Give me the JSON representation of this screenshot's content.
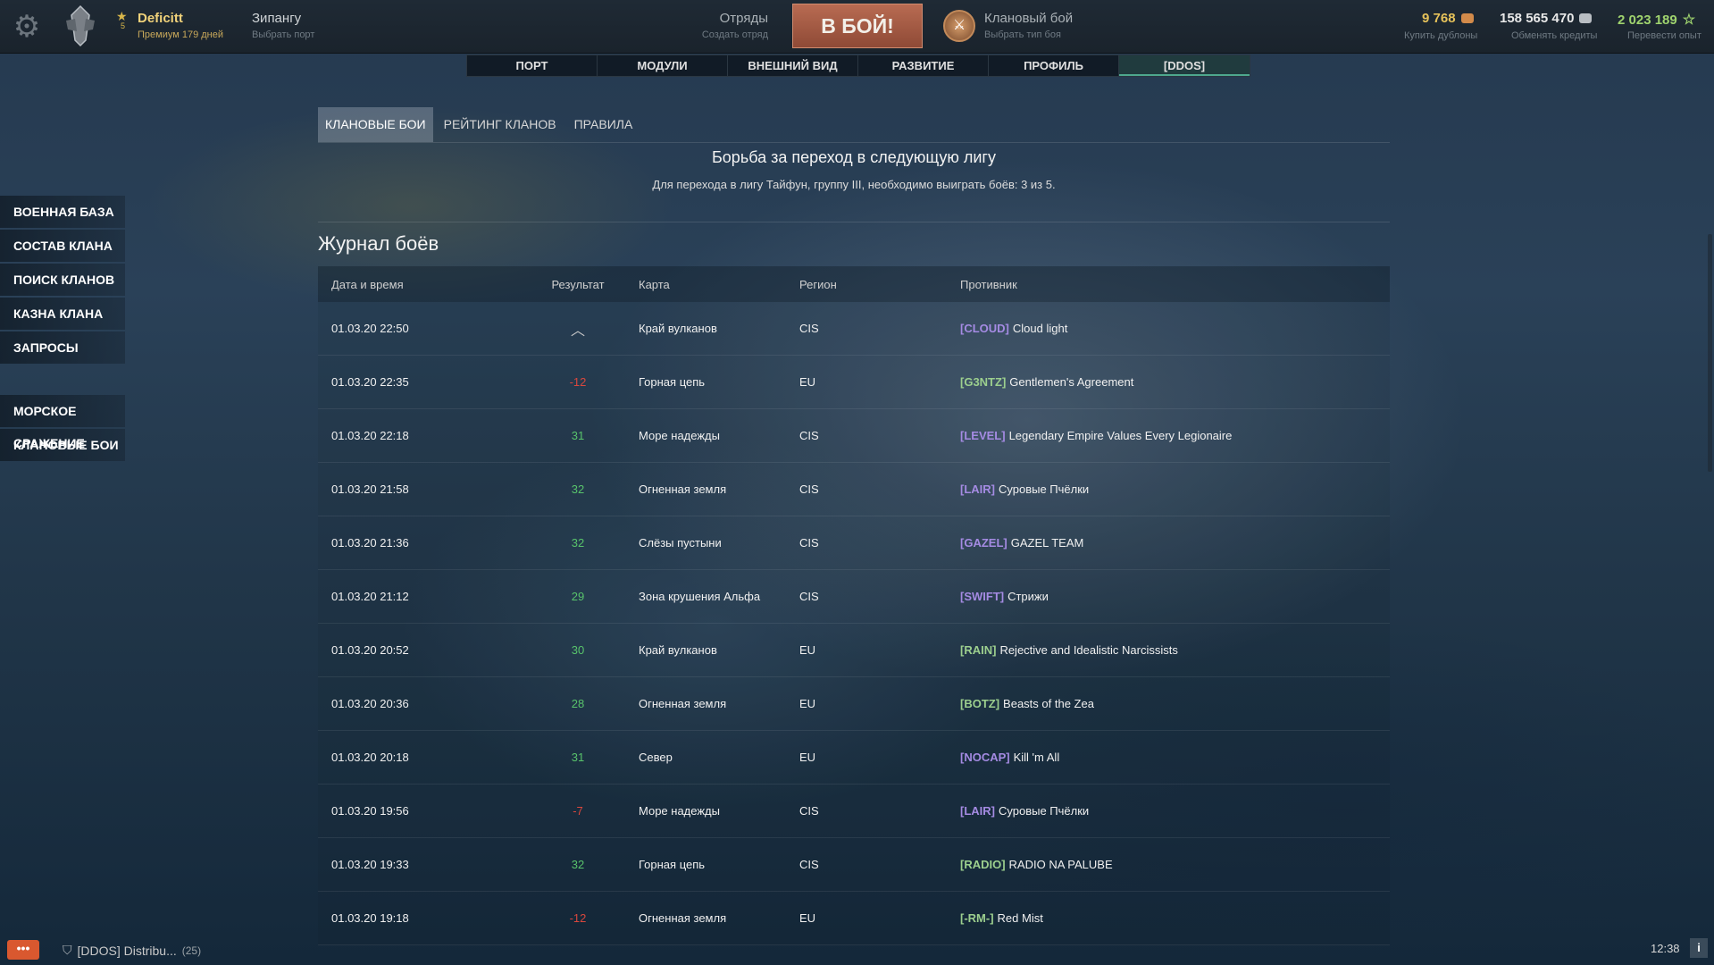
{
  "topbar": {
    "player_level": "5",
    "player_name": "Deficitt",
    "premium": "Премиум 179 дней",
    "port_name": "Зипангу",
    "port_sub": "Выбрать порт",
    "squad_label": "Отряды",
    "squad_sub": "Создать отряд",
    "battle_button": "В БОЙ!",
    "mode_name": "Клановый бой",
    "mode_sub": "Выбрать тип боя",
    "doubloons": "9 768",
    "doubloons_action": "Купить дублоны",
    "credits": "158 565 470",
    "credits_action": "Обменять кредиты",
    "xp": "2 023 189",
    "xp_action": "Перевести опыт"
  },
  "nav_tabs": [
    "ПОРТ",
    "МОДУЛИ",
    "ВНЕШНИЙ ВИД",
    "РАЗВИТИЕ",
    "ПРОФИЛЬ",
    "[DDOS]"
  ],
  "left_menu": {
    "group1": [
      "ВОЕННАЯ БАЗА",
      "СОСТАВ КЛАНА",
      "ПОИСК КЛАНОВ",
      "КАЗНА КЛАНА",
      "ЗАПРОСЫ"
    ],
    "group2": [
      "МОРСКОЕ СРАЖЕНИЕ",
      "КЛАНОВЫЕ БОИ"
    ]
  },
  "sub_tabs": [
    "КЛАНОВЫЕ БОИ",
    "РЕЙТИНГ КЛАНОВ",
    "ПРАВИЛА"
  ],
  "league": {
    "title": "Борьба за переход в следующую лигу",
    "subtitle": "Для перехода в лигу Тайфун, группу III, необходимо выиграть боёв: 3 из 5."
  },
  "log": {
    "title": "Журнал боёв",
    "headers": [
      "Дата и время",
      "Результат",
      "Карта",
      "Регион",
      "Противник"
    ],
    "rows": [
      {
        "date": "01.03.20 22:50",
        "result": "︿",
        "map": "Край вулканов",
        "region": "CIS",
        "tag": "[CLOUD]",
        "tag_color": "#a58be3",
        "opponent": "Cloud light"
      },
      {
        "date": "01.03.20 22:35",
        "result": "-12",
        "map": "Горная цепь",
        "region": "EU",
        "tag": "[G3NTZ]",
        "tag_color": "#9ccf8e",
        "opponent": "Gentlemen's Agreement"
      },
      {
        "date": "01.03.20 22:18",
        "result": "31",
        "map": "Море надежды",
        "region": "CIS",
        "tag": "[LEVEL]",
        "tag_color": "#a58be3",
        "opponent": "Legendary Empire Values Every Legionaire"
      },
      {
        "date": "01.03.20 21:58",
        "result": "32",
        "map": "Огненная земля",
        "region": "CIS",
        "tag": "[LAIR]",
        "tag_color": "#a58be3",
        "opponent": "Суровые Пчёлки"
      },
      {
        "date": "01.03.20 21:36",
        "result": "32",
        "map": "Слёзы пустыни",
        "region": "CIS",
        "tag": "[GAZEL]",
        "tag_color": "#a58be3",
        "opponent": "GAZEL TEAM"
      },
      {
        "date": "01.03.20 21:12",
        "result": "29",
        "map": "Зона крушения Альфа",
        "region": "CIS",
        "tag": "[SWIFT]",
        "tag_color": "#a58be3",
        "opponent": "Стрижи"
      },
      {
        "date": "01.03.20 20:52",
        "result": "30",
        "map": "Край вулканов",
        "region": "EU",
        "tag": "[RAIN]",
        "tag_color": "#9ccf8e",
        "opponent": "Rejective and Idealistic Narcissists"
      },
      {
        "date": "01.03.20 20:36",
        "result": "28",
        "map": "Огненная земля",
        "region": "EU",
        "tag": "[BOTZ]",
        "tag_color": "#9ccf8e",
        "opponent": "Beasts of the Zea"
      },
      {
        "date": "01.03.20 20:18",
        "result": "31",
        "map": "Север",
        "region": "EU",
        "tag": "[NOCAP]",
        "tag_color": "#a58be3",
        "opponent": "Kill 'm All"
      },
      {
        "date": "01.03.20 19:56",
        "result": "-7",
        "map": "Море надежды",
        "region": "CIS",
        "tag": "[LAIR]",
        "tag_color": "#a58be3",
        "opponent": "Суровые Пчёлки"
      },
      {
        "date": "01.03.20 19:33",
        "result": "32",
        "map": "Горная цепь",
        "region": "CIS",
        "tag": "[RADIO]",
        "tag_color": "#9ccf8e",
        "opponent": "RADIO NA PALUBE"
      },
      {
        "date": "01.03.20 19:18",
        "result": "-12",
        "map": "Огненная земля",
        "region": "EU",
        "tag": "[-RM-]",
        "tag_color": "#9ccf8e",
        "opponent": "Red Mist"
      }
    ]
  },
  "bottom": {
    "chat_icon": "•••",
    "channel": "[DDOS] Distribu...",
    "channel_count": "(25)",
    "clock": "12:38",
    "info": "i"
  },
  "colors": {
    "accent_battle": "#b86b52",
    "positive": "#58c36b",
    "negative": "#d9473d",
    "gold": "#f1d27a"
  }
}
